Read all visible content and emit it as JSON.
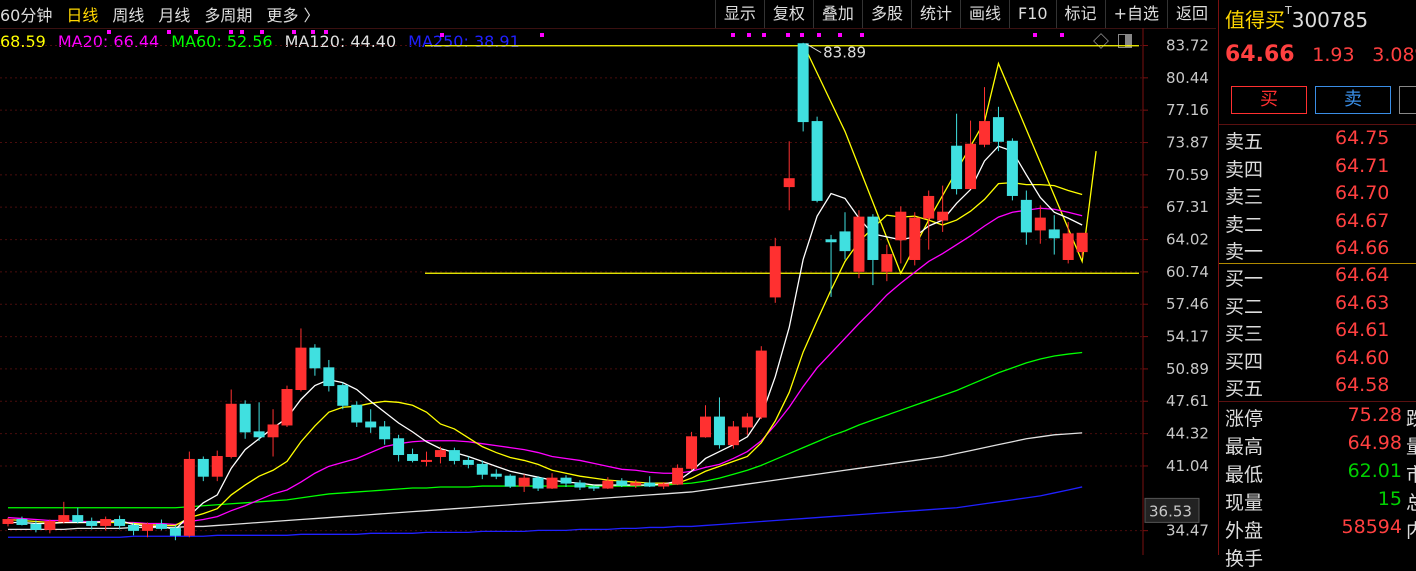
{
  "period_tabs": [
    "60分钟",
    "日线",
    "周线",
    "月线",
    "多周期",
    "更多 〉"
  ],
  "active_period": 1,
  "tools": [
    "显示",
    "复权",
    "叠加",
    "多股",
    "统计",
    "画线",
    "F10",
    "标记",
    "+自选",
    "返回"
  ],
  "ma_legend": [
    {
      "text": "68.59",
      "color": "#ffff00"
    },
    {
      "text": "MA20: 66.44",
      "color": "#ff00ff"
    },
    {
      "text": "MA60: 52.56",
      "color": "#00ff00"
    },
    {
      "text": "MA120: 44.40",
      "color": "#e0e0e0"
    },
    {
      "text": "MA250: 38.91",
      "color": "#2020ff"
    }
  ],
  "stock": {
    "name": "值得买",
    "badge": "T",
    "code": "300785",
    "price": "64.66",
    "change": "1.93",
    "pct": "3.08%"
  },
  "buttons": {
    "buy": "买",
    "sell": "卖"
  },
  "asks": [
    {
      "label": "卖五",
      "price": "64.75"
    },
    {
      "label": "卖四",
      "price": "64.71"
    },
    {
      "label": "卖三",
      "price": "64.70"
    },
    {
      "label": "卖二",
      "price": "64.67"
    },
    {
      "label": "卖一",
      "price": "64.66"
    }
  ],
  "bids": [
    {
      "label": "买一",
      "price": "64.64"
    },
    {
      "label": "买二",
      "price": "64.63"
    },
    {
      "label": "买三",
      "price": "64.61"
    },
    {
      "label": "买四",
      "price": "64.60"
    },
    {
      "label": "买五",
      "price": "64.58"
    }
  ],
  "stats": [
    {
      "label": "涨停",
      "value": "75.28",
      "tail": "跌",
      "color": "red"
    },
    {
      "label": "最高",
      "value": "64.98",
      "tail": "量",
      "color": "red"
    },
    {
      "label": "最低",
      "value": "62.01",
      "tail": "市",
      "color": "green"
    },
    {
      "label": "现量",
      "value": "15",
      "tail": "总",
      "color": "green"
    },
    {
      "label": "外盘",
      "value": "58594",
      "tail": "内",
      "color": "red"
    },
    {
      "label": "换手",
      "value": "",
      "tail": "",
      "color": "red"
    }
  ],
  "colors": {
    "up": "#ff3030",
    "down": "#40e0e0",
    "ma5": "#ffffff",
    "ma10": "#ffff00",
    "ma20": "#ff00ff",
    "ma60": "#00ff00",
    "ma120": "#e0e0e0",
    "ma250": "#2020ff",
    "hline": "#ffff00"
  },
  "chart_data": {
    "type": "candlestick",
    "y_ticks": [
      "83.72",
      "80.44",
      "77.16",
      "73.87",
      "70.59",
      "67.31",
      "64.02",
      "60.74",
      "57.46",
      "54.17",
      "50.89",
      "47.61",
      "44.32",
      "41.04",
      "36.53",
      "34.47"
    ],
    "ylim": [
      32.0,
      85.5
    ],
    "annotation": "83.89",
    "h_lines": [
      83.7,
      60.6
    ],
    "cursor_price": "36.53",
    "candles": [
      [
        35.2,
        35.8,
        34.9,
        35.6
      ],
      [
        35.6,
        35.9,
        35.0,
        35.1
      ],
      [
        35.1,
        35.5,
        34.3,
        34.6
      ],
      [
        34.6,
        35.6,
        34.2,
        35.4
      ],
      [
        35.4,
        37.4,
        35.2,
        36.0
      ],
      [
        36.0,
        36.8,
        35.2,
        35.4
      ],
      [
        35.4,
        35.8,
        34.6,
        35.0
      ],
      [
        35.0,
        35.9,
        34.5,
        35.6
      ],
      [
        35.6,
        36.0,
        34.6,
        35.0
      ],
      [
        35.0,
        35.3,
        34.0,
        34.5
      ],
      [
        34.5,
        35.3,
        33.8,
        35.1
      ],
      [
        35.1,
        35.6,
        34.5,
        34.7
      ],
      [
        34.7,
        35.0,
        33.5,
        34.0
      ],
      [
        34.0,
        42.5,
        33.8,
        41.7
      ],
      [
        41.7,
        42.0,
        39.5,
        40.0
      ],
      [
        40.0,
        42.6,
        39.5,
        42.0
      ],
      [
        42.0,
        48.8,
        41.8,
        47.3
      ],
      [
        47.3,
        47.7,
        43.8,
        44.5
      ],
      [
        44.5,
        47.5,
        43.6,
        44.0
      ],
      [
        44.0,
        46.8,
        42.0,
        45.2
      ],
      [
        45.2,
        49.2,
        45.0,
        48.8
      ],
      [
        48.8,
        55.0,
        48.6,
        53.0
      ],
      [
        53.0,
        53.4,
        50.2,
        51.0
      ],
      [
        51.0,
        51.8,
        48.6,
        49.2
      ],
      [
        49.2,
        49.5,
        46.8,
        47.2
      ],
      [
        47.2,
        47.6,
        45.0,
        45.5
      ],
      [
        45.5,
        46.8,
        44.4,
        45.0
      ],
      [
        45.0,
        45.6,
        43.2,
        43.8
      ],
      [
        43.8,
        44.2,
        41.5,
        42.2
      ],
      [
        42.2,
        42.8,
        41.4,
        41.6
      ],
      [
        41.6,
        42.5,
        41.0,
        41.6
      ],
      [
        42.0,
        43.0,
        41.3,
        42.6
      ],
      [
        42.6,
        42.9,
        41.2,
        41.6
      ],
      [
        41.6,
        42.0,
        40.8,
        41.2
      ],
      [
        41.2,
        41.6,
        39.7,
        40.2
      ],
      [
        40.2,
        40.7,
        39.7,
        40.0
      ],
      [
        40.0,
        40.2,
        38.8,
        39.0
      ],
      [
        39.0,
        40.2,
        38.4,
        39.8
      ],
      [
        39.8,
        40.0,
        38.5,
        38.8
      ],
      [
        38.8,
        40.3,
        38.7,
        39.8
      ],
      [
        39.8,
        40.1,
        38.9,
        39.3
      ],
      [
        39.3,
        39.6,
        38.6,
        38.9
      ],
      [
        38.9,
        39.1,
        38.5,
        38.8
      ],
      [
        38.8,
        39.9,
        38.7,
        39.5
      ],
      [
        39.5,
        39.8,
        38.9,
        39.1
      ],
      [
        39.1,
        39.6,
        38.8,
        39.3
      ],
      [
        39.3,
        40.0,
        38.9,
        39.0
      ],
      [
        39.0,
        39.4,
        38.7,
        39.2
      ],
      [
        39.2,
        41.2,
        39.1,
        40.8
      ],
      [
        40.8,
        44.5,
        40.6,
        44.0
      ],
      [
        44.0,
        47.2,
        43.9,
        46.0
      ],
      [
        46.0,
        48.0,
        42.8,
        43.2
      ],
      [
        43.2,
        45.6,
        42.8,
        45.0
      ],
      [
        45.0,
        46.4,
        44.2,
        46.0
      ],
      [
        46.0,
        53.2,
        45.8,
        52.7
      ],
      [
        58.2,
        64.2,
        57.6,
        63.3
      ],
      [
        69.4,
        74.0,
        67.0,
        70.2
      ],
      [
        83.9,
        84.0,
        75.0,
        76.0
      ],
      [
        76.0,
        76.5,
        67.8,
        68.0
      ],
      [
        64.0,
        64.5,
        58.2,
        63.8
      ],
      [
        64.8,
        66.8,
        62.0,
        62.9
      ],
      [
        60.8,
        67.0,
        60.1,
        66.3
      ],
      [
        66.3,
        66.6,
        59.4,
        62.0
      ],
      [
        60.8,
        63.5,
        59.8,
        62.5
      ],
      [
        64.0,
        67.4,
        61.6,
        66.8
      ],
      [
        62.0,
        66.8,
        61.4,
        66.2
      ],
      [
        66.2,
        69.0,
        63.0,
        68.4
      ],
      [
        66.0,
        69.5,
        64.8,
        66.8
      ],
      [
        73.5,
        76.8,
        68.6,
        69.2
      ],
      [
        69.2,
        76.1,
        69.5,
        73.7
      ],
      [
        73.7,
        79.5,
        73.4,
        76.0
      ],
      [
        76.4,
        77.5,
        73.0,
        74.0
      ],
      [
        74.0,
        74.3,
        68.0,
        68.5
      ],
      [
        68.0,
        69.0,
        63.5,
        64.8
      ],
      [
        65.0,
        67.5,
        63.6,
        66.2
      ],
      [
        65.0,
        66.5,
        62.5,
        64.2
      ],
      [
        62.0,
        65.8,
        61.6,
        64.6
      ],
      [
        62.8,
        64.6,
        62.2,
        64.66
      ]
    ],
    "ma5": [
      35.3,
      35.3,
      35.2,
      35.2,
      35.3,
      35.3,
      35.3,
      35.4,
      35.5,
      35.1,
      34.9,
      34.9,
      34.6,
      36.0,
      37.3,
      38.1,
      40.8,
      42.7,
      43.8,
      44.9,
      45.9,
      47.8,
      49.2,
      49.8,
      49.5,
      48.8,
      47.6,
      46.5,
      45.4,
      44.5,
      43.5,
      42.8,
      42.4,
      42.0,
      41.5,
      41.0,
      40.5,
      40.2,
      39.9,
      39.6,
      39.4,
      39.3,
      39.1,
      39.1,
      39.1,
      39.1,
      39.1,
      39.2,
      39.5,
      40.5,
      41.8,
      42.5,
      43.2,
      44.0,
      46.1,
      50.1,
      55.1,
      62.0,
      66.4,
      68.7,
      68.2,
      66.2,
      64.6,
      64.3,
      64.0,
      64.3,
      65.4,
      66.0,
      67.7,
      69.1,
      72.0,
      73.5,
      73.0,
      70.6,
      68.3,
      66.8,
      66.2,
      65.5
    ],
    "ma10": [
      35.6,
      35.5,
      35.4,
      35.3,
      35.3,
      35.3,
      35.3,
      35.3,
      35.3,
      35.2,
      35.1,
      35.0,
      35.0,
      35.8,
      36.2,
      36.7,
      38.1,
      39.1,
      40.0,
      40.6,
      41.5,
      43.5,
      45.1,
      46.5,
      47.0,
      47.1,
      47.4,
      47.6,
      47.5,
      47.2,
      46.5,
      45.3,
      44.8,
      43.9,
      43.0,
      42.4,
      41.9,
      41.6,
      41.2,
      40.6,
      40.3,
      40.0,
      39.8,
      39.6,
      39.5,
      39.4,
      39.3,
      39.3,
      39.3,
      39.8,
      40.5,
      41.0,
      41.5,
      42.0,
      43.4,
      45.6,
      48.5,
      52.6,
      55.8,
      58.9,
      61.8,
      63.8,
      65.2,
      66.5,
      66.3,
      66.4,
      66.0,
      65.5,
      66.0,
      66.9,
      68.1,
      69.7,
      69.8,
      69.6,
      69.6,
      69.5,
      69.0,
      68.6
    ],
    "ma20": [
      35.8,
      35.7,
      35.6,
      35.5,
      35.5,
      35.4,
      35.4,
      35.4,
      35.3,
      35.3,
      35.2,
      35.2,
      35.1,
      35.4,
      35.6,
      35.9,
      36.5,
      37.0,
      37.6,
      38.2,
      38.6,
      39.4,
      40.3,
      41.0,
      41.4,
      41.8,
      42.4,
      43.0,
      43.3,
      43.5,
      43.6,
      43.6,
      43.6,
      43.5,
      43.3,
      43.1,
      42.9,
      42.7,
      42.4,
      42.0,
      41.8,
      41.6,
      41.3,
      41.0,
      40.7,
      40.6,
      40.4,
      40.3,
      40.3,
      40.5,
      40.9,
      41.2,
      41.8,
      42.5,
      43.6,
      45.2,
      47.0,
      49.1,
      51.0,
      52.5,
      54.0,
      55.5,
      56.9,
      58.4,
      59.6,
      60.7,
      61.8,
      62.6,
      63.5,
      64.4,
      65.4,
      66.3,
      66.8,
      67.0,
      67.2,
      67.1,
      66.8,
      66.44
    ],
    "ma60": [
      36.8,
      36.8,
      36.8,
      36.8,
      36.8,
      36.8,
      36.8,
      36.8,
      36.8,
      36.8,
      36.8,
      36.8,
      36.8,
      36.9,
      37.0,
      37.1,
      37.2,
      37.3,
      37.4,
      37.5,
      37.6,
      37.8,
      38.0,
      38.2,
      38.3,
      38.4,
      38.5,
      38.6,
      38.7,
      38.8,
      38.8,
      38.9,
      38.9,
      38.9,
      39.0,
      39.0,
      39.0,
      39.0,
      39.0,
      39.0,
      39.0,
      39.0,
      39.0,
      39.0,
      39.0,
      39.0,
      39.1,
      39.1,
      39.2,
      39.3,
      39.5,
      39.8,
      40.2,
      40.6,
      41.1,
      41.7,
      42.3,
      42.9,
      43.5,
      44.1,
      44.6,
      45.2,
      45.7,
      46.2,
      46.7,
      47.2,
      47.7,
      48.2,
      48.7,
      49.3,
      49.9,
      50.5,
      51.0,
      51.5,
      51.9,
      52.2,
      52.4,
      52.56
    ],
    "ma120": [
      34.6,
      34.6,
      34.6,
      34.6,
      34.6,
      34.7,
      34.7,
      34.7,
      34.7,
      34.8,
      34.8,
      34.8,
      34.8,
      34.9,
      34.9,
      35.0,
      35.1,
      35.2,
      35.3,
      35.4,
      35.5,
      35.6,
      35.7,
      35.8,
      35.9,
      36.0,
      36.1,
      36.2,
      36.3,
      36.4,
      36.5,
      36.6,
      36.7,
      36.8,
      36.9,
      37.0,
      37.1,
      37.2,
      37.3,
      37.4,
      37.5,
      37.6,
      37.7,
      37.8,
      37.9,
      38.0,
      38.1,
      38.2,
      38.3,
      38.4,
      38.6,
      38.8,
      39.0,
      39.2,
      39.4,
      39.6,
      39.8,
      40.0,
      40.2,
      40.4,
      40.6,
      40.8,
      41.0,
      41.2,
      41.4,
      41.6,
      41.8,
      42.0,
      42.3,
      42.6,
      42.9,
      43.2,
      43.5,
      43.8,
      44.0,
      44.2,
      44.3,
      44.4
    ],
    "ma250": [
      33.8,
      33.8,
      33.8,
      33.8,
      33.8,
      33.8,
      33.8,
      33.8,
      33.8,
      33.9,
      33.9,
      33.9,
      33.9,
      33.9,
      33.9,
      34.0,
      34.0,
      34.0,
      34.0,
      34.0,
      34.0,
      34.1,
      34.1,
      34.1,
      34.1,
      34.1,
      34.2,
      34.2,
      34.2,
      34.2,
      34.3,
      34.3,
      34.3,
      34.3,
      34.4,
      34.4,
      34.4,
      34.4,
      34.5,
      34.5,
      34.5,
      34.6,
      34.6,
      34.6,
      34.7,
      34.7,
      34.8,
      34.8,
      34.9,
      34.9,
      35.0,
      35.1,
      35.2,
      35.3,
      35.4,
      35.5,
      35.6,
      35.7,
      35.8,
      35.9,
      36.0,
      36.1,
      36.2,
      36.3,
      36.4,
      36.5,
      36.6,
      36.7,
      36.8,
      37.0,
      37.2,
      37.4,
      37.6,
      37.8,
      38.0,
      38.3,
      38.6,
      38.91
    ]
  }
}
